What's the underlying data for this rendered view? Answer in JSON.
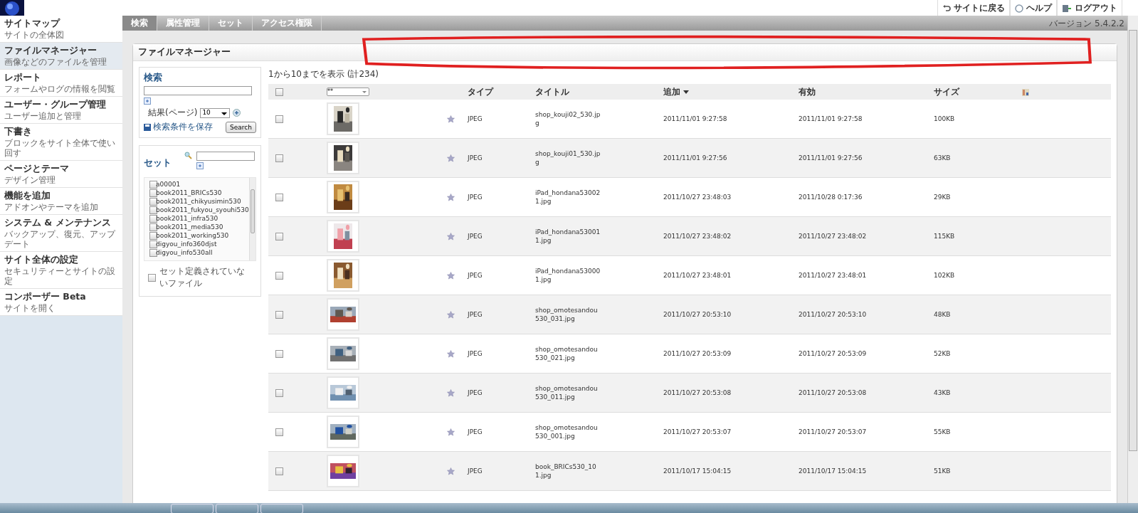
{
  "header": {
    "links": [
      {
        "label": "サイトに戻る",
        "kind": "back"
      },
      {
        "label": "ヘルプ",
        "kind": "help"
      },
      {
        "label": "ログアウト",
        "kind": "logout"
      }
    ],
    "version": "バージョン 5.4.2.2"
  },
  "sidebar": {
    "items": [
      {
        "title": "サイトマップ",
        "subtitle": "サイトの全体図",
        "selected": false
      },
      {
        "title": "ファイルマネージャー",
        "subtitle": "画像などのファイルを管理",
        "selected": true
      },
      {
        "title": "レポート",
        "subtitle": "フォームやログの情報を閲覧",
        "selected": false
      },
      {
        "title": "ユーザー・グループ管理",
        "subtitle": "ユーザー追加と管理",
        "selected": false
      },
      {
        "title": "下書き",
        "subtitle": "ブロックをサイト全体で使い回す",
        "selected": false
      },
      {
        "title": "ページとテーマ",
        "subtitle": "デザイン管理",
        "selected": false
      },
      {
        "title": "機能を追加",
        "subtitle": "アドオンやテーマを追加",
        "selected": false
      },
      {
        "title": "システム & メンテナンス",
        "subtitle": "バックアップ、復元、アップデート",
        "selected": false
      },
      {
        "title": "サイト全体の設定",
        "subtitle": "セキュリティーとサイトの設定",
        "selected": false
      },
      {
        "title": "コンポーザー Beta",
        "subtitle": "サイトを開く",
        "selected": false
      }
    ]
  },
  "tabs": [
    {
      "label": "検索",
      "selected": true
    },
    {
      "label": "属性管理",
      "selected": false
    },
    {
      "label": "セット",
      "selected": false
    },
    {
      "label": "アクセス権限",
      "selected": false
    }
  ],
  "panel": {
    "title": "ファイルマネージャー"
  },
  "search": {
    "title": "検索",
    "per_page_label": "結果(ページ)",
    "per_page": "10",
    "save_link": "検索条件を保存",
    "button": "Search"
  },
  "sets": {
    "title": "セット",
    "items": [
      {
        "label": "a00001",
        "checked": false
      },
      {
        "label": "book2011_BRICs530",
        "checked": false
      },
      {
        "label": "book2011_chikyusimin530",
        "checked": false
      },
      {
        "label": "book2011_fukyou_syouhi530",
        "checked": false
      },
      {
        "label": "book2011_infra530",
        "checked": false
      },
      {
        "label": "book2011_media530",
        "checked": false
      },
      {
        "label": "book2011_working530",
        "checked": false
      },
      {
        "label": "digyou_info360djst",
        "checked": false
      },
      {
        "label": "digyou_info530all",
        "checked": false
      }
    ],
    "unassigned": {
      "label": "セット定義されていないファイル",
      "checked": false
    }
  },
  "table": {
    "summary": "1から10までを表示 (計234)",
    "select_all": {
      "checked": false
    },
    "filter": "**",
    "columns": [
      "タイプ",
      "タイトル",
      "追加",
      "有効",
      "サイズ"
    ],
    "rows": [
      {
        "checked": false,
        "type": "JPEG",
        "title": "shop_kouji02_530.jpg",
        "added": "2011/11/01 9:27:58",
        "active": "2011/11/01 9:27:58",
        "size": "100KB"
      },
      {
        "checked": false,
        "type": "JPEG",
        "title": "shop_kouji01_530.jpg",
        "added": "2011/11/01 9:27:56",
        "active": "2011/11/01 9:27:56",
        "size": "63KB"
      },
      {
        "checked": false,
        "type": "JPEG",
        "title": "iPad_hondana530021.jpg",
        "added": "2011/10/27 23:48:03",
        "active": "2011/10/28 0:17:36",
        "size": "29KB"
      },
      {
        "checked": false,
        "type": "JPEG",
        "title": "iPad_hondana530011.jpg",
        "added": "2011/10/27 23:48:02",
        "active": "2011/10/27 23:48:02",
        "size": "115KB"
      },
      {
        "checked": false,
        "type": "JPEG",
        "title": "iPad_hondana530001.jpg",
        "added": "2011/10/27 23:48:01",
        "active": "2011/10/27 23:48:01",
        "size": "102KB"
      },
      {
        "checked": false,
        "type": "JPEG",
        "title": "shop_omotesandou530_031.jpg",
        "added": "2011/10/27 20:53:10",
        "active": "2011/10/27 20:53:10",
        "size": "48KB"
      },
      {
        "checked": false,
        "type": "JPEG",
        "title": "shop_omotesandou530_021.jpg",
        "added": "2011/10/27 20:53:09",
        "active": "2011/10/27 20:53:09",
        "size": "52KB"
      },
      {
        "checked": false,
        "type": "JPEG",
        "title": "shop_omotesandou530_011.jpg",
        "added": "2011/10/27 20:53:08",
        "active": "2011/10/27 20:53:08",
        "size": "43KB"
      },
      {
        "checked": false,
        "type": "JPEG",
        "title": "shop_omotesandou530_001.jpg",
        "added": "2011/10/27 20:53:07",
        "active": "2011/10/27 20:53:07",
        "size": "55KB"
      },
      {
        "checked": false,
        "type": "JPEG",
        "title": "book_BRICs530_101.jpg",
        "added": "2011/10/17 15:04:15",
        "active": "2011/10/17 15:04:15",
        "size": "51KB"
      }
    ]
  }
}
